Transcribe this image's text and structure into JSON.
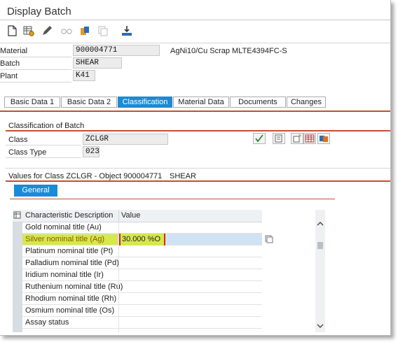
{
  "window": {
    "title": "Display Batch"
  },
  "toolbar": {
    "icons": [
      "new-document-icon",
      "table-settings-icon",
      "edit-pencil-icon",
      "glasses-display-icon",
      "clipboard-icon",
      "copy-icon",
      "download-tray-icon"
    ]
  },
  "header": {
    "material_label": "Material",
    "material_value": "900004771",
    "material_desc": "AgNi10/Cu Scrap MLTE4394FC-S",
    "batch_label": "Batch",
    "batch_value": "SHEAR",
    "plant_label": "Plant",
    "plant_value": "K41"
  },
  "tabs": [
    "Basic Data 1",
    "Basic Data 2",
    "Classification",
    "Material Data",
    "Documents",
    "Changes"
  ],
  "classification": {
    "section_title": "Classification of Batch",
    "class_label": "Class",
    "class_value": "ZCLGR",
    "class_type_label": "Class Type",
    "class_type_value": "023"
  },
  "values": {
    "title": "Values for Class ZCLGR - Object 900004771",
    "batch": "SHEAR",
    "general_tab": "General"
  },
  "grid": {
    "col_desc": "Characteristic Description",
    "col_value": "Value",
    "rows": [
      {
        "desc": "Gold nominal title (Au)",
        "value": ""
      },
      {
        "desc": "Silver nominal title (Ag)",
        "value": "30.000 %O"
      },
      {
        "desc": "Platinum nominal title (Pt)",
        "value": ""
      },
      {
        "desc": "Palladium nominal title (Pd)",
        "value": ""
      },
      {
        "desc": "Iridium nominal title (Ir)",
        "value": ""
      },
      {
        "desc": "Ruthenium nominal title (Ru)",
        "value": ""
      },
      {
        "desc": "Rhodium nominal title (Rh)",
        "value": ""
      },
      {
        "desc": "Osmium nominal title (Os)",
        "value": ""
      },
      {
        "desc": "Assay status",
        "value": ""
      }
    ]
  },
  "colors": {
    "accent": "#1a8bd6",
    "divider": "#c0522b",
    "highlight": "#d6e84a",
    "selected_row": "#cfe3f4"
  }
}
